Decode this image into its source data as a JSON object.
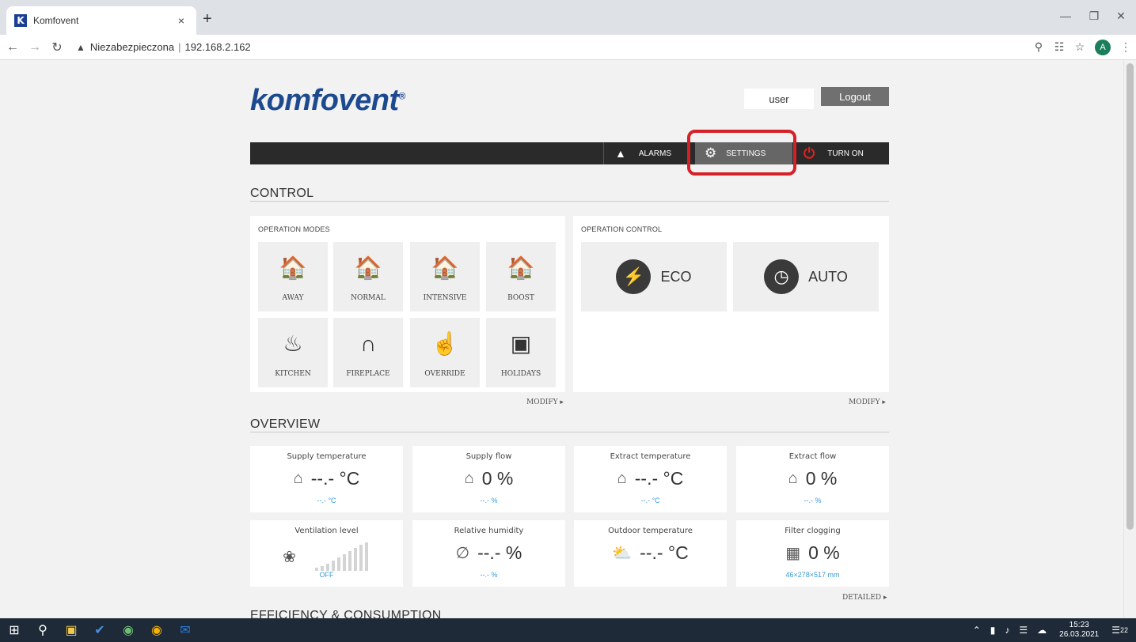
{
  "browser": {
    "tab_title": "Komfovent",
    "tab_favicon": "K",
    "tab_close": "×",
    "new_tab": "+",
    "security_label": "Niezabezpieczona",
    "separator": "|",
    "url": "192.168.2.162",
    "profile_initial": "A"
  },
  "header": {
    "logo": "komfovent",
    "logo_mark": "®",
    "user": "user",
    "logout": "Logout"
  },
  "menu": {
    "alarms": "ALARMS",
    "settings": "SETTINGS",
    "turn_on": "TURN ON"
  },
  "control": {
    "title": "CONTROL",
    "operation_modes_label": "OPERATION MODES",
    "operation_control_label": "OPERATION CONTROL",
    "modes": [
      {
        "label": "AWAY",
        "icon": "away-house-icon"
      },
      {
        "label": "NORMAL",
        "icon": "normal-house-icon"
      },
      {
        "label": "INTENSIVE",
        "icon": "intensive-house-icon"
      },
      {
        "label": "BOOST",
        "icon": "boost-house-icon"
      },
      {
        "label": "KITCHEN",
        "icon": "kitchen-pot-icon"
      },
      {
        "label": "FIREPLACE",
        "icon": "fireplace-icon"
      },
      {
        "label": "OVERRIDE",
        "icon": "override-hand-icon"
      },
      {
        "label": "HOLIDAYS",
        "icon": "suitcase-icon"
      }
    ],
    "controls": [
      {
        "label": "ECO",
        "icon": "eco-plug-icon"
      },
      {
        "label": "AUTO",
        "icon": "clock-icon"
      }
    ],
    "modify_left": "MODIFY ▸",
    "modify_right": "MODIFY ▸"
  },
  "overview": {
    "title": "OVERVIEW",
    "cards": [
      {
        "title": "Supply temperature",
        "value": "--.- °C",
        "sub": "--.- °C",
        "icon": "supply-house-icon"
      },
      {
        "title": "Supply flow",
        "value": "0 %",
        "sub": "--.- %",
        "icon": "supply-house-icon"
      },
      {
        "title": "Extract temperature",
        "value": "--.- °C",
        "sub": "--.- °C",
        "icon": "extract-house-icon"
      },
      {
        "title": "Extract flow",
        "value": "0 %",
        "sub": "--.- %",
        "icon": "extract-house-icon"
      },
      {
        "title": "Ventilation level",
        "value": "",
        "sub": "OFF",
        "icon": "fan-icon",
        "level": 0
      },
      {
        "title": "Relative humidity",
        "value": "--.- %",
        "sub": "--.- %",
        "icon": "leaf-icon"
      },
      {
        "title": "Outdoor temperature",
        "value": "--.- °C",
        "sub": "",
        "icon": "sun-cloud-icon"
      },
      {
        "title": "Filter clogging",
        "value": "0 %",
        "sub": "46×278×517 mm",
        "icon": "filter-icon"
      }
    ],
    "detailed": "DETAILED ▸"
  },
  "efficiency": {
    "title": "EFFICIENCY & CONSUMPTION"
  },
  "taskbar": {
    "time": "15:23",
    "date": "26.03.2021",
    "notifications": "22"
  },
  "colors": {
    "brand": "#1d4a8f",
    "highlight": "#d62027",
    "accent_blue": "#3a9ad9",
    "menu_bg": "#2a2a2a"
  }
}
